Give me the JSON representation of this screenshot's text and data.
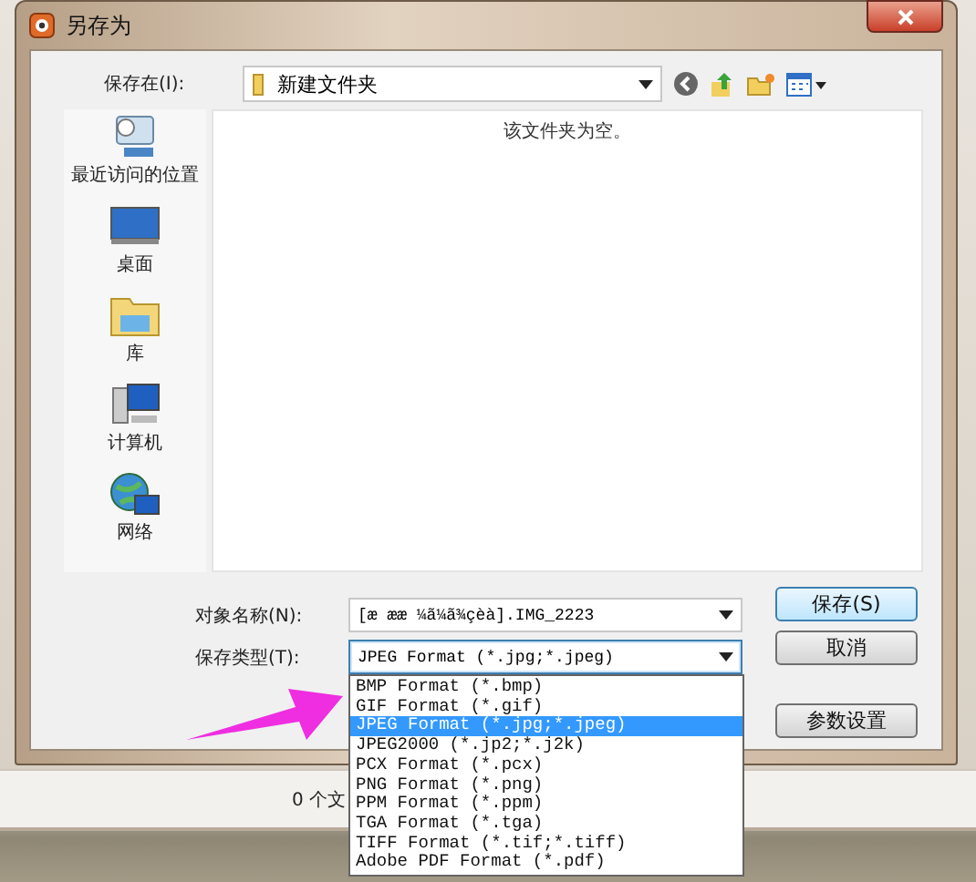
{
  "window": {
    "title": "另存为"
  },
  "location": {
    "label": "保存在(I):",
    "value": "新建文件夹"
  },
  "sidebar": {
    "items": [
      {
        "label": "最近访问的位置",
        "kind": "recent"
      },
      {
        "label": "桌面",
        "kind": "desktop"
      },
      {
        "label": "库",
        "kind": "library"
      },
      {
        "label": "计算机",
        "kind": "computer"
      },
      {
        "label": "网络",
        "kind": "network"
      }
    ]
  },
  "file_list": {
    "empty_message": "该文件夹为空。"
  },
  "filename": {
    "label": "对象名称(N):",
    "value": "[æ ææ ¼ã¼ã¾çèà].IMG_2223"
  },
  "filetype": {
    "label": "保存类型(T):",
    "value": "JPEG Format (*.jpg;*.jpeg)",
    "expanded": true,
    "options": [
      {
        "label": "BMP Format (*.bmp)",
        "selected": false
      },
      {
        "label": "GIF Format (*.gif)",
        "selected": false
      },
      {
        "label": "JPEG Format (*.jpg;*.jpeg)",
        "selected": true
      },
      {
        "label": "JPEG2000 (*.jp2;*.j2k)",
        "selected": false
      },
      {
        "label": "PCX Format (*.pcx)",
        "selected": false
      },
      {
        "label": "PNG Format (*.png)",
        "selected": false
      },
      {
        "label": "PPM Format (*.ppm)",
        "selected": false
      },
      {
        "label": "TGA Format (*.tga)",
        "selected": false
      },
      {
        "label": "TIFF Format (*.tif;*.tiff)",
        "selected": false
      },
      {
        "label": "Adobe PDF Format (*.pdf)",
        "selected": false
      }
    ]
  },
  "buttons": [
    {
      "label": "保存(S)",
      "kind": "default"
    },
    {
      "label": "取消",
      "kind": "normal"
    },
    {
      "label": "参数设置",
      "kind": "normal"
    }
  ],
  "status_bar": {
    "text": "0 个文"
  }
}
